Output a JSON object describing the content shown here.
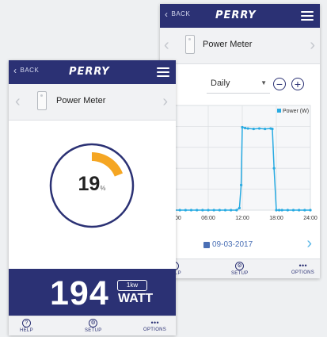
{
  "screens": {
    "back": {
      "topbar": {
        "back_label": "BACK",
        "brand": "PERRY"
      },
      "device": {
        "name": "Power Meter"
      },
      "period": {
        "selected": "Daily"
      },
      "zoom": {
        "out": "−",
        "in": "+"
      },
      "date": "09-03-2017",
      "nav": {
        "help": "HELP",
        "setup": "SETUP",
        "options": "OPTIONS"
      }
    },
    "front": {
      "topbar": {
        "back_label": "BACK",
        "brand": "PERRY"
      },
      "device": {
        "name": "Power Meter"
      },
      "gauge": {
        "percent": 19,
        "percent_unit": "%"
      },
      "power": {
        "value": "194",
        "scale": "1kw",
        "unit": "WATT"
      },
      "nav": {
        "help": "HELP",
        "setup": "SETUP",
        "options": "OPTIONS"
      }
    }
  },
  "icons": {
    "back": "chevron-left-icon",
    "menu": "hamburger-menu-icon",
    "prev_device": "chevron-left-icon",
    "next_device": "chevron-right-icon",
    "help": "question-circle-icon",
    "setup": "gear-icon",
    "options": "dots-icon",
    "calendar": "calendar-icon"
  },
  "colors": {
    "brand_navy": "#2b3174",
    "gauge_orange": "#f5a623",
    "chart_line": "#29abe2",
    "accent_blue": "#5bb8e8"
  },
  "chart_data": {
    "type": "line",
    "legend": [
      "Power (W)"
    ],
    "legend_position": "top-right",
    "x_ticks": [
      "00:00",
      "06:00",
      "12:00",
      "18:00",
      "24:00"
    ],
    "xlim_hours": [
      0,
      24
    ],
    "ylim": [
      0,
      250
    ],
    "grid": true,
    "series": [
      {
        "name": "Power (W)",
        "x": [
          0,
          1,
          2,
          3,
          4,
          5,
          6,
          7,
          8,
          9,
          10,
          11,
          11.5,
          11.8,
          12,
          12.5,
          13,
          14,
          15,
          16,
          17,
          17.3,
          17.6,
          18,
          18.5,
          19,
          20,
          21,
          22,
          23,
          24
        ],
        "y": [
          0,
          0,
          0,
          0,
          0,
          0,
          0,
          0,
          0,
          0,
          0,
          0,
          5,
          60,
          198,
          196,
          195,
          194,
          195,
          194,
          195,
          194,
          100,
          0,
          0,
          0,
          0,
          0,
          0,
          0,
          0
        ]
      }
    ]
  }
}
